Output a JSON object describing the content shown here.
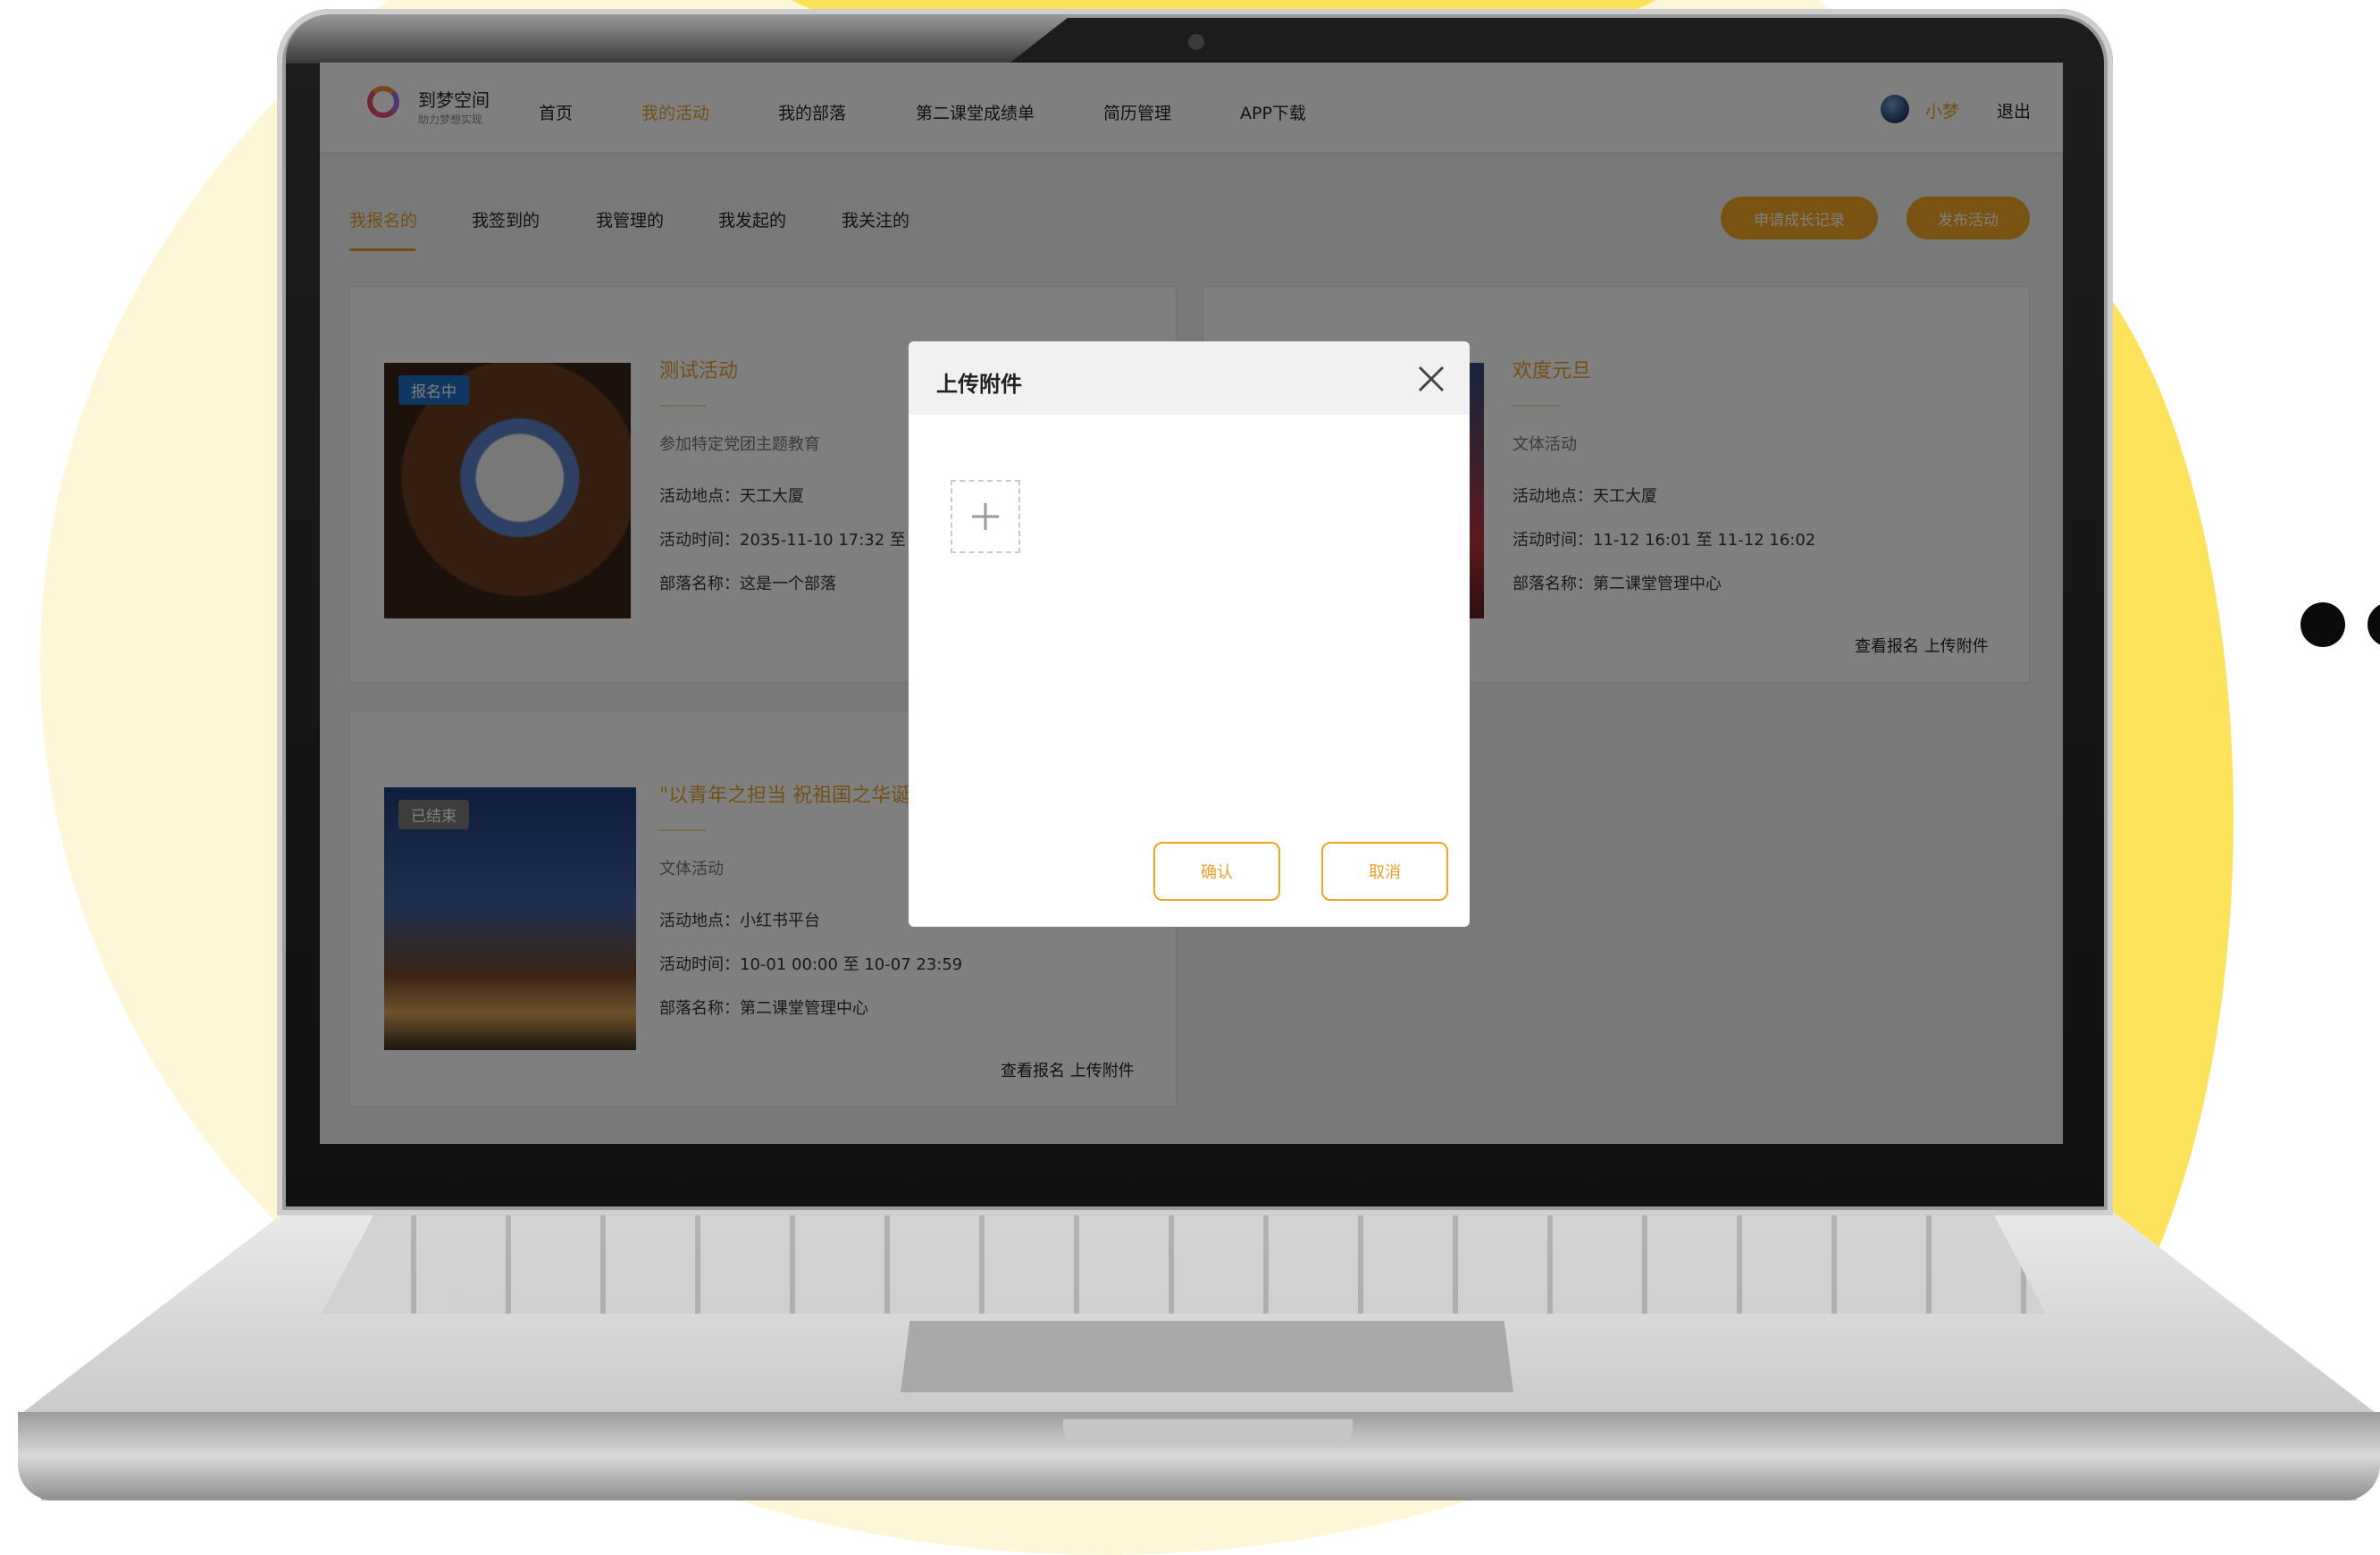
{
  "brand": {
    "name": "到梦空间",
    "tagline": "助力梦想实现",
    "logo_colors": [
      "#e34a6b",
      "#9b6bdf",
      "#f08a3a"
    ]
  },
  "nav": {
    "items": [
      "首页",
      "我的活动",
      "我的部落",
      "第二课堂成绩单",
      "简历管理",
      "APP下载"
    ],
    "active": "我的活动",
    "user": {
      "name": "小梦"
    },
    "logout": "退出"
  },
  "subtabs": {
    "items": [
      "我报名的",
      "我签到的",
      "我管理的",
      "我发起的",
      "我关注的"
    ],
    "active": "我报名的",
    "actions": [
      "申请成长记录",
      "发布活动"
    ]
  },
  "activities": [
    {
      "badge": "报名中",
      "title": "测试活动",
      "category": "参加特定党团主题教育",
      "location": "活动地点：天工大厦",
      "time": "活动时间：2035-11-10 17:32 至",
      "tribe": "部落名称：这是一个部落"
    },
    {
      "title": "欢度元旦",
      "category": "文体活动",
      "location": "活动地点：天工大厦",
      "time": "活动时间：11-12 16:01 至 11-12 16:02",
      "tribe": "部落名称：第二课堂管理中心",
      "links": "查看报名 上传附件"
    },
    {
      "badge": "已结束",
      "title": "\"以青年之担当 祝祖国之华诞",
      "category": "文体活动",
      "location": "活动地点：小红书平台",
      "time": "活动时间：10-01 00:00 至 10-07 23:59",
      "tribe": "部落名称：第二课堂管理中心",
      "links": "查看报名 上传附件"
    }
  ],
  "modal": {
    "title": "上传附件",
    "confirm": "确认",
    "cancel": "取消",
    "icons": {
      "close": "close-icon",
      "upload": "plus-icon"
    }
  },
  "colors": {
    "accent": "#e7a12d",
    "button": "#f0a623",
    "badge_open": "#1f6fc4",
    "badge_closed": "#7a7a7a"
  }
}
